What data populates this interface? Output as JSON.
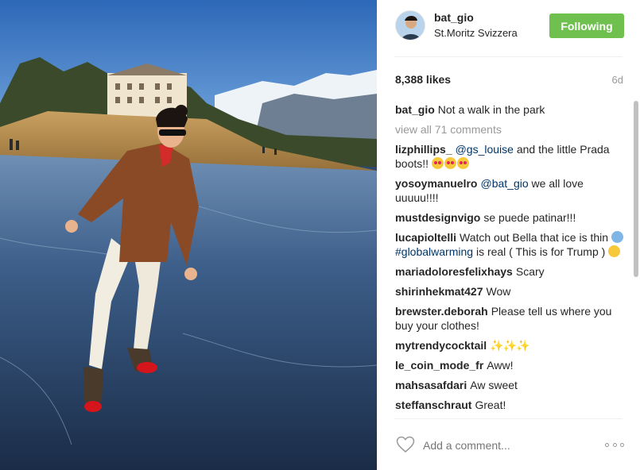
{
  "post": {
    "author": "bat_gio",
    "location": "St.Moritz Svizzera",
    "follow_label": "Following",
    "likes": "8,388 likes",
    "age": "6d",
    "caption_user": "bat_gio",
    "caption_text": "Not a walk in the park",
    "view_all": "view all 71 comments",
    "add_comment_placeholder": "Add a comment...",
    "accent_color": "#70c050"
  },
  "comments": [
    {
      "user": "lizphillips_",
      "mention": "@gs_louise",
      "text": " and the little Prada boots!!"
    },
    {
      "user": "yosoymanuelro",
      "mention": "@bat_gio",
      "text": " we all love uuuuu!!!!"
    },
    {
      "user": "mustdesignvigo",
      "text": "se puede patinar!!!"
    },
    {
      "user": "lucapioltelli",
      "text_a": "Watch out Bella that ice is thin ",
      "mention": "#globalwarming",
      "text_b": " is real ( This is for Trump )"
    },
    {
      "user": "mariadoloresfelixhays",
      "text": "Scary"
    },
    {
      "user": "shirinhekmat427",
      "text": "Wow"
    },
    {
      "user": "brewster.deborah",
      "text": "Please tell us where you buy your clothes!"
    },
    {
      "user": "mytrendycocktail",
      "text": "✨✨✨"
    },
    {
      "user": "le_coin_mode_fr",
      "text": "Aww!"
    },
    {
      "user": "mahsasafdari",
      "text": "Aw sweet"
    },
    {
      "user": "steffanschraut",
      "text": "Great!"
    }
  ]
}
